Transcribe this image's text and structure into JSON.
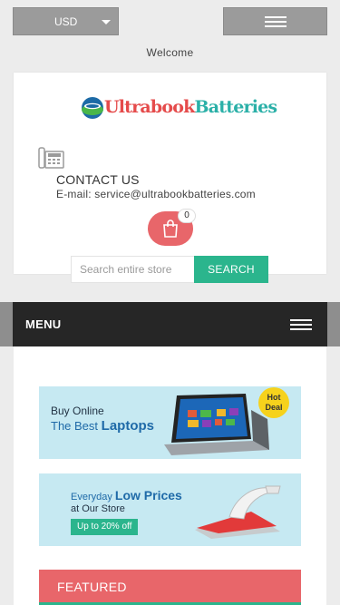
{
  "topbar": {
    "currency_label": "USD",
    "currency_icon": "chevron-down-icon",
    "menu_icon": "hamburger-icon"
  },
  "welcome_text": "Welcome",
  "header": {
    "logo": {
      "part1": "Ultrabook",
      "part2": "Batteries",
      "icon": "globe-logo-icon"
    },
    "contact": {
      "icon": "phone-icon",
      "title": "CONTACT US",
      "email": "E-mail: service@ultrabookbatteries.com"
    },
    "cart": {
      "icon": "shopping-bag-icon",
      "count": "0"
    },
    "search": {
      "placeholder": "Search entire store",
      "value": "",
      "button_label": "SEARCH"
    }
  },
  "menubar": {
    "label": "MENU",
    "icon": "hamburger-icon"
  },
  "banners": [
    {
      "line1": "Buy Online",
      "line2_prefix": "The Best",
      "line2_highlight": "Laptops",
      "badge": "Hot Deal",
      "image": "laptop-image"
    },
    {
      "line1_prefix": "Everyday",
      "line1_highlight": "Low Prices",
      "line2": "at Our Store",
      "badge": "Up to 20% off",
      "image": "iron-image"
    }
  ],
  "featured_label": "FEATURED",
  "colors": {
    "accent_red": "#e8666a",
    "accent_green": "#2bb58d",
    "menubar": "#262626",
    "banner_bg": "#c6e9f2"
  }
}
